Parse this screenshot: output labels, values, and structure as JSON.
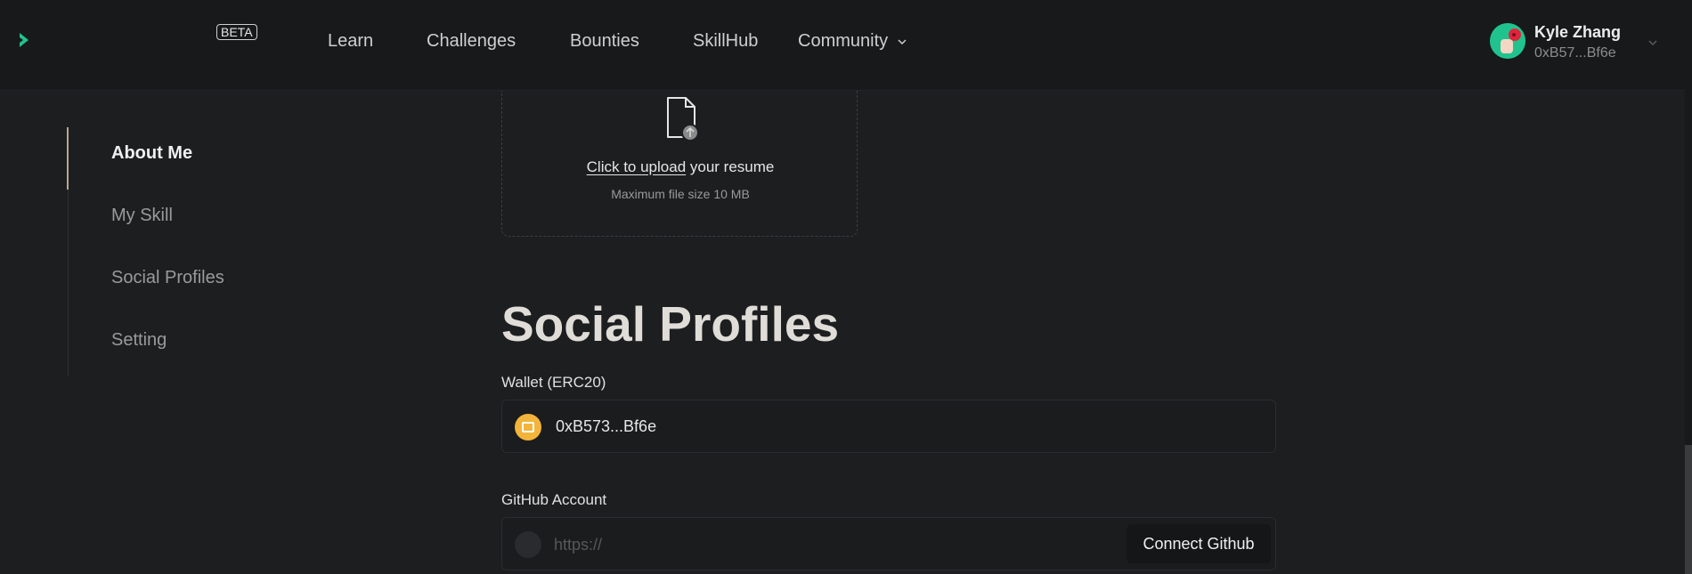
{
  "header": {
    "beta_badge": "BETA",
    "nav": {
      "learn": "Learn",
      "challenges": "Challenges",
      "bounties": "Bounties",
      "skillhub": "SkillHub",
      "community": "Community"
    },
    "user": {
      "name": "Kyle Zhang",
      "address": "0xB57...Bf6e"
    }
  },
  "sidebar": {
    "items": [
      {
        "label": "About Me",
        "active": true
      },
      {
        "label": "My Skill",
        "active": false
      },
      {
        "label": "Social Profiles",
        "active": false
      },
      {
        "label": "Setting",
        "active": false
      }
    ]
  },
  "upload": {
    "link_text": "Click to upload",
    "rest_text": " your resume",
    "max_size": "Maximum file size 10 MB"
  },
  "social": {
    "title": "Social Profiles",
    "wallet_label": "Wallet (ERC20)",
    "wallet_value": "0xB573...Bf6e",
    "github_label": "GitHub Account",
    "github_placeholder": "https://",
    "github_button": "Connect Github"
  },
  "colors": {
    "background": "#1d1e20",
    "brand_green": "#20c38e",
    "wallet_yellow": "#f2b43a",
    "active_accent": "#b8a68f"
  }
}
